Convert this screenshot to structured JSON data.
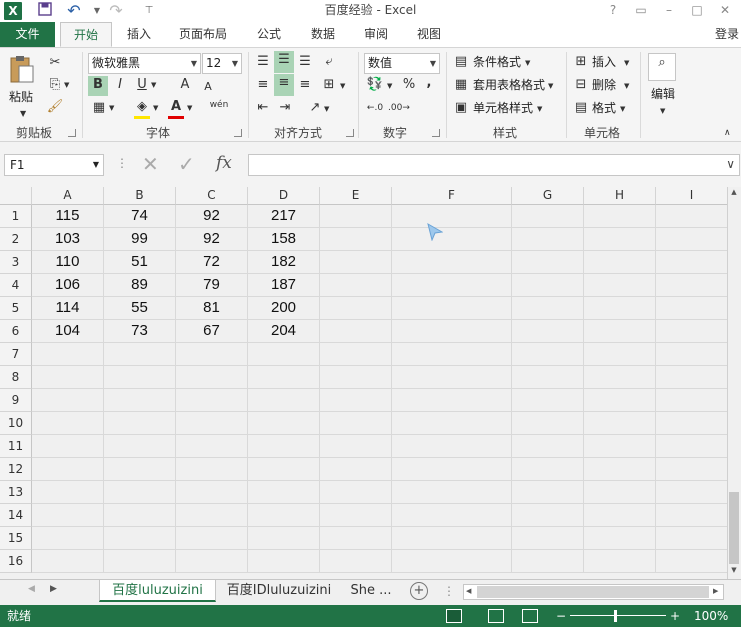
{
  "window": {
    "title": "百度经验 - Excel",
    "login": "登录"
  },
  "quick_access": {
    "undo": "↶",
    "redo": "↷"
  },
  "ribbon_tabs": [
    "文件",
    "开始",
    "插入",
    "页面布局",
    "公式",
    "数据",
    "审阅",
    "视图"
  ],
  "clipboard": {
    "paste": "粘贴",
    "group": "剪贴板"
  },
  "font": {
    "name": "微软雅黑",
    "size": "12",
    "bold": "B",
    "italic": "I",
    "underline": "U",
    "grow": "A",
    "shrink": "A",
    "wen": "wén",
    "group": "字体"
  },
  "alignment": {
    "group": "对齐方式"
  },
  "number": {
    "format": "数值",
    "percent": "%",
    "comma": ",",
    "group": "数字"
  },
  "styles": {
    "conditional": "条件格式",
    "table": "套用表格格式",
    "cell": "单元格样式",
    "group": "样式"
  },
  "cells": {
    "insert": "插入",
    "delete": "删除",
    "format": "格式",
    "group": "单元格"
  },
  "editing": {
    "label": "编辑"
  },
  "formula_bar": {
    "name_box": "F1",
    "fx": "fx",
    "value": ""
  },
  "columns": [
    "A",
    "B",
    "C",
    "D",
    "E",
    "F",
    "G",
    "H",
    "I"
  ],
  "rows": [
    "1",
    "2",
    "3",
    "4",
    "5",
    "6",
    "7",
    "8",
    "9",
    "10",
    "11",
    "12",
    "13",
    "14",
    "15",
    "16"
  ],
  "data": [
    [
      "115",
      "74",
      "92",
      "217"
    ],
    [
      "103",
      "99",
      "92",
      "158"
    ],
    [
      "110",
      "51",
      "72",
      "182"
    ],
    [
      "106",
      "89",
      "79",
      "187"
    ],
    [
      "114",
      "55",
      "81",
      "200"
    ],
    [
      "104",
      "73",
      "67",
      "204"
    ]
  ],
  "sheets": [
    "百度luluzuizini",
    "百度IDluluzuizini",
    "She ..."
  ],
  "status": {
    "ready": "就绪",
    "zoom": "100%"
  },
  "colors": {
    "accent": "#217346",
    "selected_tab_text": "#217346"
  }
}
